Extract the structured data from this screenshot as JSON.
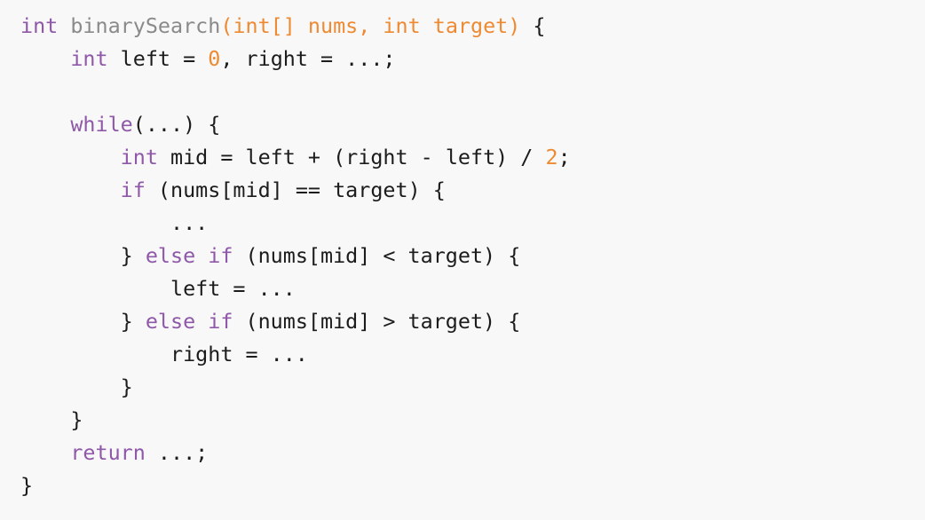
{
  "colors": {
    "background": "#f8f8f8",
    "keyword": "#8f58a8",
    "function_name": "#8a8a8a",
    "parameter": "#ed8a32",
    "number": "#ed8a32",
    "plain": "#1c1c1c"
  },
  "code": {
    "lines": [
      {
        "tokens": [
          {
            "text": "int",
            "type": "keyword"
          },
          {
            "text": " ",
            "type": "plain"
          },
          {
            "text": "binarySearch",
            "type": "func"
          },
          {
            "text": "(int[] nums, int target)",
            "type": "param"
          },
          {
            "text": " {",
            "type": "punct"
          }
        ]
      },
      {
        "tokens": [
          {
            "text": "    ",
            "type": "plain"
          },
          {
            "text": "int",
            "type": "keyword"
          },
          {
            "text": " left = ",
            "type": "plain"
          },
          {
            "text": "0",
            "type": "number"
          },
          {
            "text": ", right = ...;",
            "type": "plain"
          }
        ]
      },
      {
        "tokens": [
          {
            "text": "",
            "type": "plain"
          }
        ]
      },
      {
        "tokens": [
          {
            "text": "    ",
            "type": "plain"
          },
          {
            "text": "while",
            "type": "keyword"
          },
          {
            "text": "(...) {",
            "type": "plain"
          }
        ]
      },
      {
        "tokens": [
          {
            "text": "        ",
            "type": "plain"
          },
          {
            "text": "int",
            "type": "keyword"
          },
          {
            "text": " mid = left + (right - left) / ",
            "type": "plain"
          },
          {
            "text": "2",
            "type": "number"
          },
          {
            "text": ";",
            "type": "plain"
          }
        ]
      },
      {
        "tokens": [
          {
            "text": "        ",
            "type": "plain"
          },
          {
            "text": "if",
            "type": "keyword"
          },
          {
            "text": " (nums[mid] == target) {",
            "type": "plain"
          }
        ]
      },
      {
        "tokens": [
          {
            "text": "            ...",
            "type": "plain"
          }
        ]
      },
      {
        "tokens": [
          {
            "text": "        } ",
            "type": "plain"
          },
          {
            "text": "else if",
            "type": "keyword"
          },
          {
            "text": " (nums[mid] < target) {",
            "type": "plain"
          }
        ]
      },
      {
        "tokens": [
          {
            "text": "            left = ...",
            "type": "plain"
          }
        ]
      },
      {
        "tokens": [
          {
            "text": "        } ",
            "type": "plain"
          },
          {
            "text": "else if",
            "type": "keyword"
          },
          {
            "text": " (nums[mid] > target) {",
            "type": "plain"
          }
        ]
      },
      {
        "tokens": [
          {
            "text": "            right = ...",
            "type": "plain"
          }
        ]
      },
      {
        "tokens": [
          {
            "text": "        }",
            "type": "plain"
          }
        ]
      },
      {
        "tokens": [
          {
            "text": "    }",
            "type": "plain"
          }
        ]
      },
      {
        "tokens": [
          {
            "text": "    ",
            "type": "plain"
          },
          {
            "text": "return",
            "type": "keyword"
          },
          {
            "text": " ...;",
            "type": "plain"
          }
        ]
      },
      {
        "tokens": [
          {
            "text": "}",
            "type": "plain"
          }
        ]
      }
    ]
  }
}
